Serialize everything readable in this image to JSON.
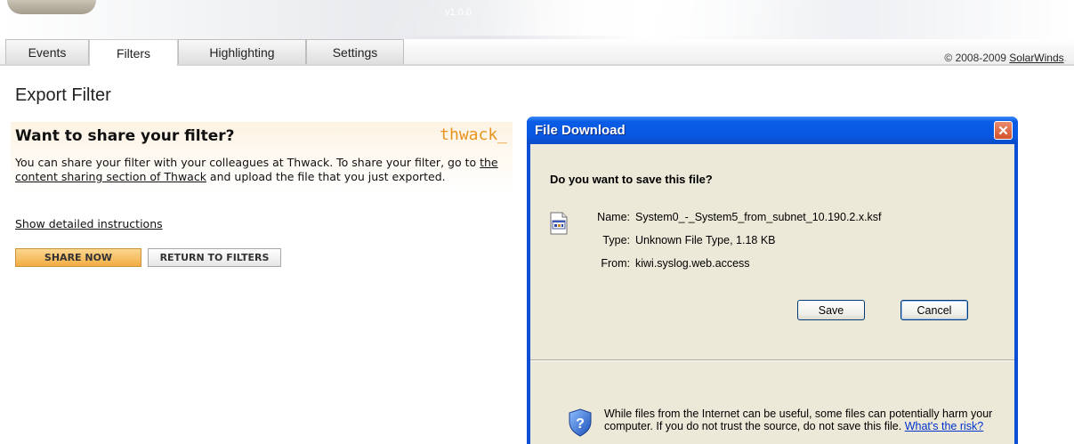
{
  "banner": {
    "version": "v1.0.0"
  },
  "tabs": [
    {
      "label": "Events",
      "active": false
    },
    {
      "label": "Filters",
      "active": true
    },
    {
      "label": "Highlighting",
      "active": false
    },
    {
      "label": "Settings",
      "active": false
    }
  ],
  "copyright": {
    "text": "© 2008-2009 ",
    "link": "SolarWinds",
    "link_fade": "."
  },
  "page": {
    "title": "Export Filter"
  },
  "share": {
    "heading": "Want to share your filter?",
    "brand": "thwack_",
    "text_before": "You can share your filter with your colleagues at Thwack.  To share your filter, go to ",
    "link": "the content sharing section of Thwack",
    "text_after": " and upload the file that you just exported.",
    "show_instructions": "Show detailed instructions",
    "share_button": "SHARE NOW",
    "return_button": "RETURN TO FILTERS"
  },
  "dialog": {
    "title": "File Download",
    "close": "✕",
    "question": "Do you want to save this file?",
    "name_label": "Name:",
    "name_value": "System0_-_System5_from_subnet_10.190.2.x.ksf",
    "type_label": "Type:",
    "type_value": "Unknown File Type, 1.18 KB",
    "from_label": "From:",
    "from_value": "kiwi.syslog.web.access",
    "save_button": "Save",
    "cancel_button": "Cancel",
    "warning_text": "While files from the Internet can be useful, some files can potentially harm your computer. If you do not trust the source, do not save this file. ",
    "risk_link": "What's the risk?"
  },
  "colors": {
    "accent_orange": "#e8931e",
    "xp_title_blue": "#0858e0",
    "dialog_face": "#ece9d8"
  }
}
